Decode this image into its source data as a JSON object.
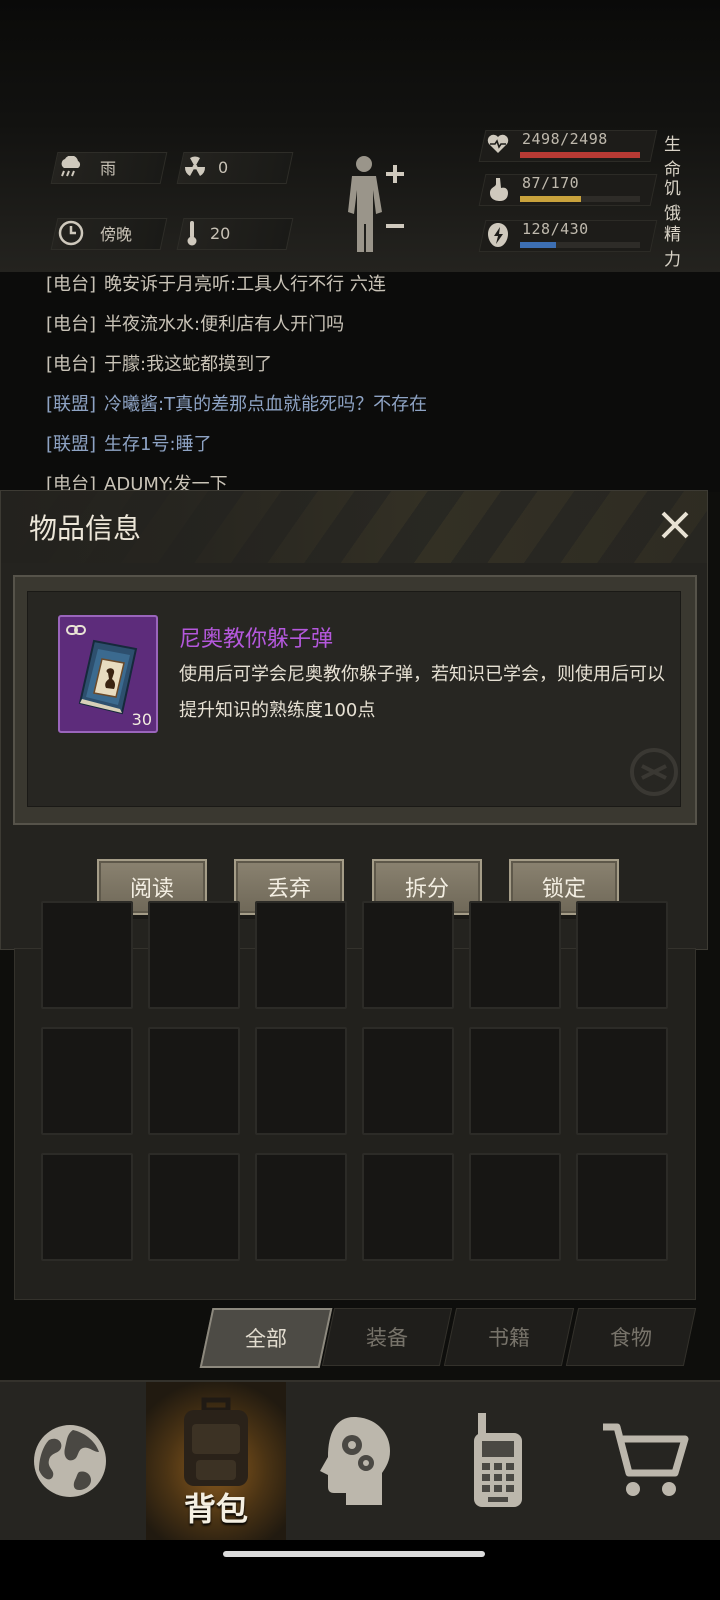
{
  "status": {
    "weather": {
      "icon": "rain-cloud-icon",
      "label": "雨"
    },
    "radiation": {
      "icon": "radiation-icon",
      "value": "0"
    },
    "time_of_day": {
      "icon": "clock-icon",
      "label": "傍晚"
    },
    "temperature": {
      "icon": "thermometer-icon",
      "value": "20"
    },
    "vitals": [
      {
        "icon": "heart-icon",
        "value": "2498/2498",
        "label": "生命",
        "fraction": 1.0,
        "color": "#b83a34"
      },
      {
        "icon": "stomach-icon",
        "value": "87/170",
        "label": "饥饿",
        "fraction": 0.51,
        "color": "#c8a23c"
      },
      {
        "icon": "energy-icon",
        "value": "128/430",
        "label": "精力",
        "fraction": 0.3,
        "color": "#3d6fb3"
      }
    ]
  },
  "chat": [
    {
      "channel": "[电台]",
      "text": "晚安诉于月亮听:工具人行不行 六连",
      "type": "radio"
    },
    {
      "channel": "[电台]",
      "text": "半夜流水水:便利店有人开门吗",
      "type": "radio"
    },
    {
      "channel": "[电台]",
      "text": "于朦:我这蛇都摸到了",
      "type": "radio"
    },
    {
      "channel": "[联盟]",
      "text": "冷曦酱:T真的差那点血就能死吗？不存在",
      "type": "alliance"
    },
    {
      "channel": "[联盟]",
      "text": "生存1号:睡了",
      "type": "alliance"
    },
    {
      "channel": "[电台]",
      "text": "ADUMY:发一下",
      "type": "radio"
    }
  ],
  "item_panel": {
    "title": "物品信息",
    "item": {
      "name": "尼奥教你躲子弹",
      "description": "使用后可学会尼奥教你躲子弹，若知识已学会，则使用后可以提升知识的熟练度100点",
      "count": "30",
      "rarity_color": "#b458dc"
    },
    "actions": {
      "read": "阅读",
      "discard": "丢弃",
      "split": "拆分",
      "lock": "锁定"
    }
  },
  "tabs": [
    {
      "label": "全部",
      "active": true
    },
    {
      "label": "装备",
      "active": false
    },
    {
      "label": "书籍",
      "active": false
    },
    {
      "label": "食物",
      "active": false
    }
  ],
  "nav": {
    "world": "globe-icon",
    "bag": {
      "label": "背包",
      "icon": "backpack-icon"
    },
    "skills": "head-gears-icon",
    "radio": "walkie-talkie-icon",
    "shop": "shopping-cart-icon"
  }
}
